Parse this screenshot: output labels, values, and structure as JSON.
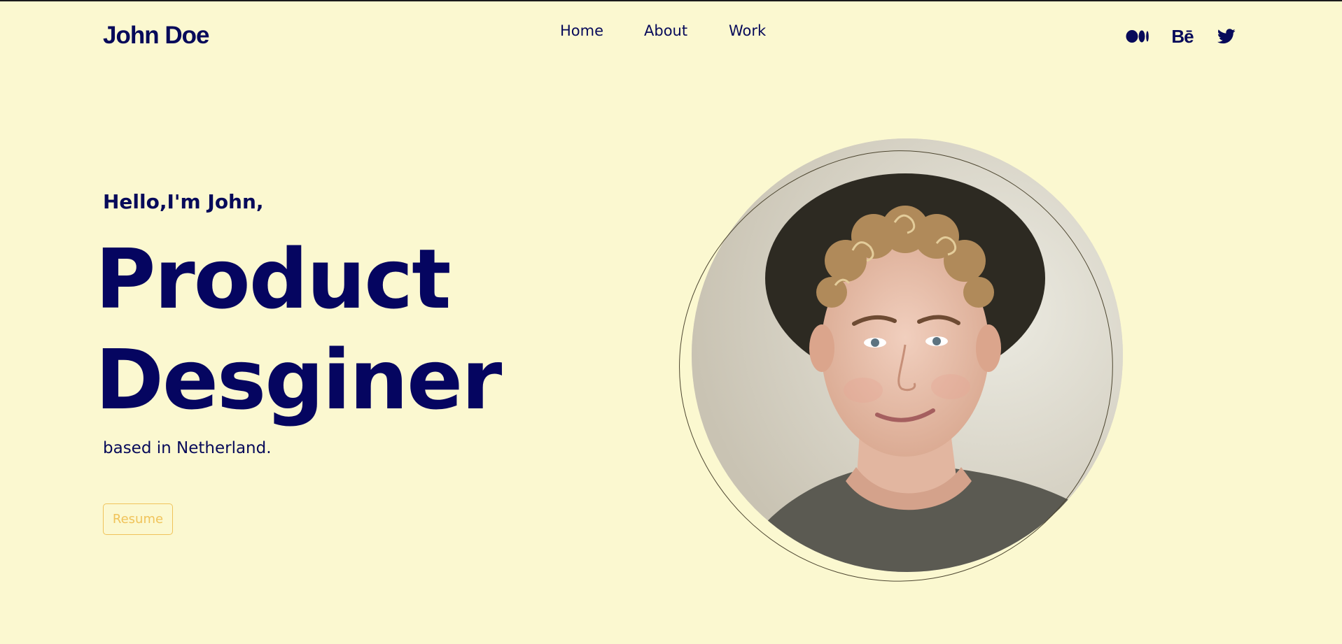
{
  "header": {
    "logo": "John Doe",
    "nav": [
      "Home",
      "About",
      "Work"
    ],
    "social": [
      {
        "name": "medium-icon"
      },
      {
        "name": "behance-icon",
        "glyph": "Bē"
      },
      {
        "name": "twitter-icon"
      }
    ]
  },
  "hero": {
    "greeting": "Hello,I'm John,",
    "title_line1": "Product",
    "title_line2": "Desginer",
    "location": "based in Netherland.",
    "resume_label": "Resume"
  },
  "colors": {
    "background": "#fbf8d0",
    "primary": "#070a5a",
    "accent": "#f0c35a"
  }
}
